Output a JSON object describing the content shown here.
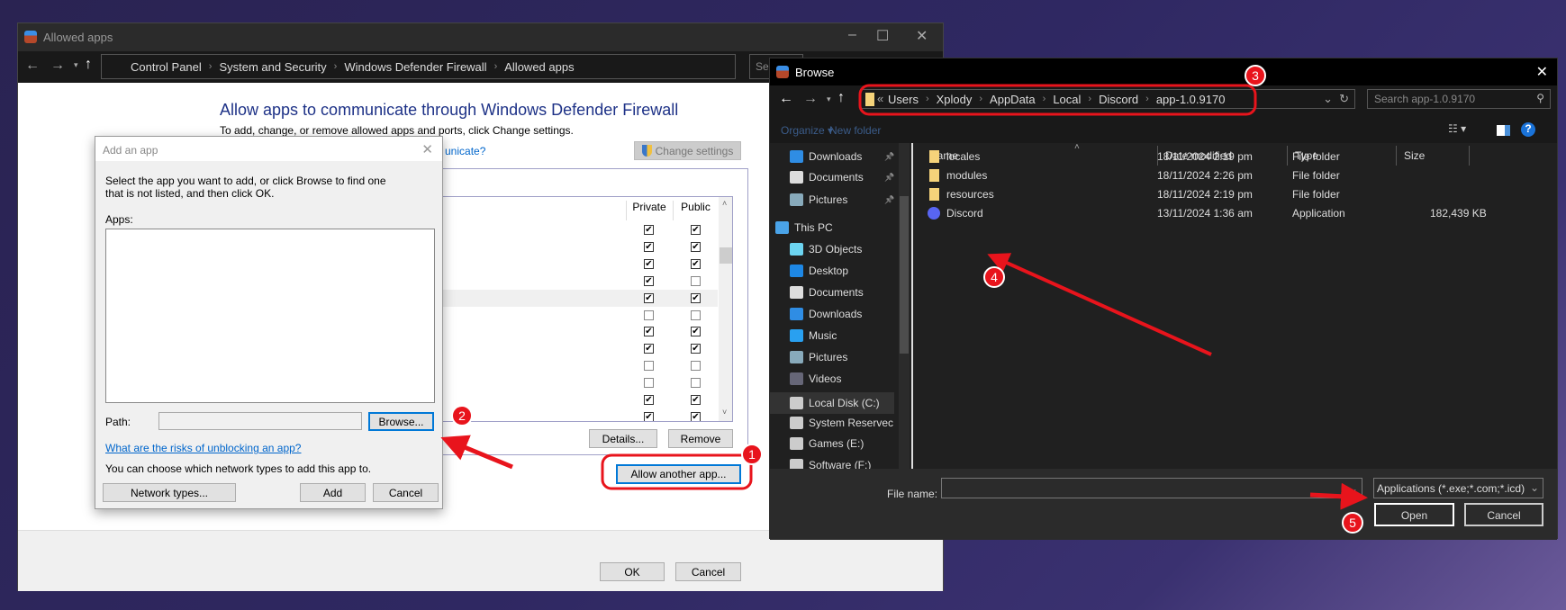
{
  "firewall_window": {
    "title": "Allowed apps",
    "breadcrumbs": [
      "Control Panel",
      "System and Security",
      "Windows Defender Firewall",
      "Allowed apps"
    ],
    "search_placeholder": "Se",
    "heading": "Allow apps to communicate through Windows Defender Firewall",
    "subheading": "To add, change, or remove allowed apps and ports, click Change settings.",
    "risk_link_partial": "unicate?",
    "change_settings": "Change settings",
    "columns": {
      "private": "Private",
      "public": "Public"
    },
    "rows": [
      {
        "private": true,
        "public": true
      },
      {
        "private": true,
        "public": true
      },
      {
        "private": true,
        "public": true
      },
      {
        "private": true,
        "public": false
      },
      {
        "private": true,
        "public": true,
        "selected": true
      },
      {
        "private": false,
        "public": false
      },
      {
        "private": true,
        "public": true
      },
      {
        "private": true,
        "public": true
      },
      {
        "private": false,
        "public": false
      },
      {
        "private": false,
        "public": false
      },
      {
        "private": true,
        "public": true
      },
      {
        "private": true,
        "public": true
      }
    ],
    "details": "Details...",
    "remove": "Remove",
    "allow_another": "Allow another app...",
    "ok": "OK",
    "cancel": "Cancel"
  },
  "add_app_dialog": {
    "title": "Add an app",
    "instructions": "Select the app you want to add, or click Browse to find one that is not listed, and then click OK.",
    "apps_label": "Apps:",
    "path_label": "Path:",
    "path_value": "",
    "browse": "Browse...",
    "risk_link": "What are the risks of unblocking an app?",
    "network_text": "You can choose which network types to add this app to.",
    "network_types": "Network types...",
    "add": "Add",
    "cancel": "Cancel"
  },
  "browse_dialog": {
    "title": "Browse",
    "path": [
      "Users",
      "Xplody",
      "AppData",
      "Local",
      "Discord",
      "app-1.0.9170"
    ],
    "search_placeholder": "Search app-1.0.9170",
    "organize": "Organize ▾",
    "new_folder": "New folder",
    "nav": [
      {
        "label": "Downloads",
        "icon": "download-icon",
        "pinned": true
      },
      {
        "label": "Documents",
        "icon": "document-icon",
        "pinned": true
      },
      {
        "label": "Pictures",
        "icon": "pictures-icon",
        "pinned": true
      },
      {
        "label": "This PC",
        "icon": "computer-icon",
        "top": true
      },
      {
        "label": "3D Objects",
        "icon": "cube-icon"
      },
      {
        "label": "Desktop",
        "icon": "desktop-icon"
      },
      {
        "label": "Documents",
        "icon": "document-icon"
      },
      {
        "label": "Downloads",
        "icon": "download-icon"
      },
      {
        "label": "Music",
        "icon": "music-icon"
      },
      {
        "label": "Pictures",
        "icon": "pictures-icon"
      },
      {
        "label": "Videos",
        "icon": "video-icon"
      },
      {
        "label": "Local Disk (C:)",
        "icon": "drive-icon",
        "selected": true
      },
      {
        "label": "System Reservec",
        "icon": "drive-icon"
      },
      {
        "label": "Games (E:)",
        "icon": "drive-icon"
      },
      {
        "label": "Software (F:)",
        "icon": "drive-icon"
      }
    ],
    "columns": [
      "Name",
      "Date modified",
      "Type",
      "Size"
    ],
    "files": [
      {
        "name": "locales",
        "date": "18/11/2024 2:19 pm",
        "type": "File folder",
        "size": "",
        "icon": "folder-icon"
      },
      {
        "name": "modules",
        "date": "18/11/2024 2:26 pm",
        "type": "File folder",
        "size": "",
        "icon": "folder-icon"
      },
      {
        "name": "resources",
        "date": "18/11/2024 2:19 pm",
        "type": "File folder",
        "size": "",
        "icon": "folder-icon"
      },
      {
        "name": "Discord",
        "date": "13/11/2024 1:36 am",
        "type": "Application",
        "size": "182,439 KB",
        "icon": "discord-icon"
      }
    ],
    "file_name_label": "File name:",
    "file_name_value": "",
    "filter": "Applications (*.exe;*.com;*.icd)",
    "open": "Open",
    "cancel": "Cancel"
  },
  "annotations": {
    "steps": [
      "1",
      "2",
      "3",
      "4",
      "5"
    ],
    "color": "#e8141c"
  }
}
